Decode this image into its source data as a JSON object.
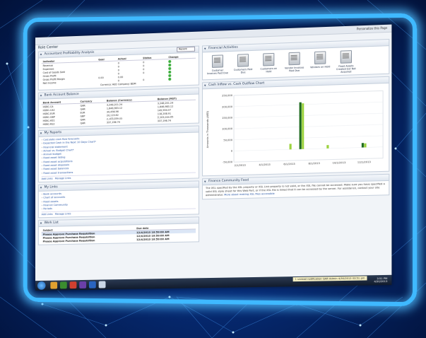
{
  "window": {
    "personalize": "Personalize this Page",
    "role_center": "Role Center"
  },
  "accountant_analysis": {
    "title": "Accountant Profitability Analysis",
    "headers": [
      "Indicator",
      "Goal",
      "Actual",
      "Status",
      "Change"
    ],
    "rows": [
      [
        "Revenue",
        "",
        "0",
        "0",
        ""
      ],
      [
        "Expenses",
        "",
        "0",
        "0",
        ""
      ],
      [
        "Cost of Goods Sold",
        "",
        "0",
        "0",
        ""
      ],
      [
        "Gross Profit",
        "",
        "0",
        "0",
        ""
      ],
      [
        "Gross Profit Margin",
        "0.00",
        "0.00",
        "",
        ""
      ],
      [
        "Net Income",
        "",
        "0",
        "0",
        ""
      ]
    ],
    "currency_note": "Currency: AED Company: BDM"
  },
  "bank_balance": {
    "title": "Bank Account Balance",
    "headers": [
      "Bank Account",
      "Currency",
      "Balance (Currency)",
      "Balance (MST)"
    ],
    "rows": [
      [
        "HSBC-CA",
        "QAR",
        "3,248,201.24",
        "3,248,201.24"
      ],
      [
        "HSBC-CA2",
        "QAR",
        "1,646,983.12",
        "1,646,983.12"
      ],
      [
        "HSBC-EUR",
        "EUR",
        "30,456.56",
        "149,594.07"
      ],
      [
        "HSBC-GBP",
        "GBP",
        "20,119.62",
        "118,208.91"
      ],
      [
        "HSBC-RS1",
        "QAR",
        "2,103,039.05",
        "2,103,039.05"
      ],
      [
        "HSBC-RS2",
        "QAR",
        "337,196.74",
        "337,196.74"
      ]
    ]
  },
  "my_reports": {
    "title": "My Reports",
    "dropdown": "Recent",
    "items": [
      "Calculate cash flow forecasts",
      "Expected Cash in the Next 10 Days Chart*",
      "Financial statement",
      "Actual vs. Budget Chart*",
      "Annual budget",
      "Fixed asset listing",
      "Fixed asset acquisitions",
      "Fixed asset disposals",
      "Fixed asset balances",
      "Fixed asset transactions"
    ],
    "add_link": "Add Links",
    "manage_link": "Manage Links"
  },
  "my_links": {
    "title": "My Links",
    "dropdown": "Recent",
    "items": [
      "Bank accounts",
      "Chart of accounts",
      "Fixed assets",
      "Finance Community",
      "Periods"
    ],
    "add_link": "Add Links",
    "manage_link": "Manage Links"
  },
  "work_list": {
    "title": "Work List",
    "headers": [
      "Subject",
      "Due date"
    ],
    "rows": [
      [
        "Please Approve Purchase Requisition",
        "12/4/2013 10:59:00 AM"
      ],
      [
        "Please Approve Purchase Requisition",
        "12/4/2013 10:59:00 AM"
      ],
      [
        "Please Approve Purchase Requisition",
        "12/4/2013 10:59:00 AM"
      ]
    ]
  },
  "financial_activities": {
    "title": "Financial Activities",
    "items": [
      "Customer Invoices Past Due",
      "Customers Past Due",
      "Customers on Hold",
      "Vendor Invoices Past Due",
      "Vendors on Hold",
      "Fixed Assets Created but Not Acquired"
    ]
  },
  "cash_chart": {
    "title": "Cash Inflow vs. Cash Outflow Chart"
  },
  "chart_data": {
    "type": "bar",
    "title": "",
    "ylabel": "Amounts in Thousands (AED)",
    "xlabel": "",
    "ylim": [
      -50000,
      250000
    ],
    "y_ticks": [
      "250,000",
      "200,000",
      "150,000",
      "100,000",
      "50,000",
      "0",
      "-50,000"
    ],
    "categories": [
      "2/1/2013",
      "3/1/2013",
      "4/1/2013",
      "5/1/2013",
      "6/1/2013",
      "7/1/2013",
      "8/1/2013",
      "9/1/2013",
      "10/1/2013",
      "11/1/2013",
      "12/1/2013",
      "1/1/2014"
    ],
    "x_tick_labels": [
      "2/1/2013",
      "4/1/2013",
      "6/1/2013",
      "8/1/2013",
      "10/1/2013",
      "12/1/2013"
    ],
    "series": [
      {
        "color": "#1e6b1e",
        "values": [
          0,
          0,
          0,
          0,
          0,
          210000,
          0,
          0,
          0,
          0,
          20000,
          0
        ]
      },
      {
        "color": "#9bd23c",
        "values": [
          0,
          0,
          0,
          0,
          25000,
          205000,
          0,
          15000,
          0,
          0,
          18000,
          0
        ]
      }
    ]
  },
  "community_feed": {
    "title": "Finance Community Feed",
    "text": "The XSL specified by the XSL property or XSL Link property is not valid, or the XSL file cannot be accessed. Make sure you have specified a valid XSL style sheet for this Web Part, or if the XSL file is linked that it can be accessed by the server. For assistance, contact your site administrator.",
    "link": "More about making XSL files accessible"
  },
  "taskbar": {
    "notification": "1 unread notification",
    "company": "QAR",
    "user": "Admin",
    "date_status": "4/30/2013 03:51 pm",
    "time": "3:51 PM",
    "date": "4/30/2013"
  }
}
